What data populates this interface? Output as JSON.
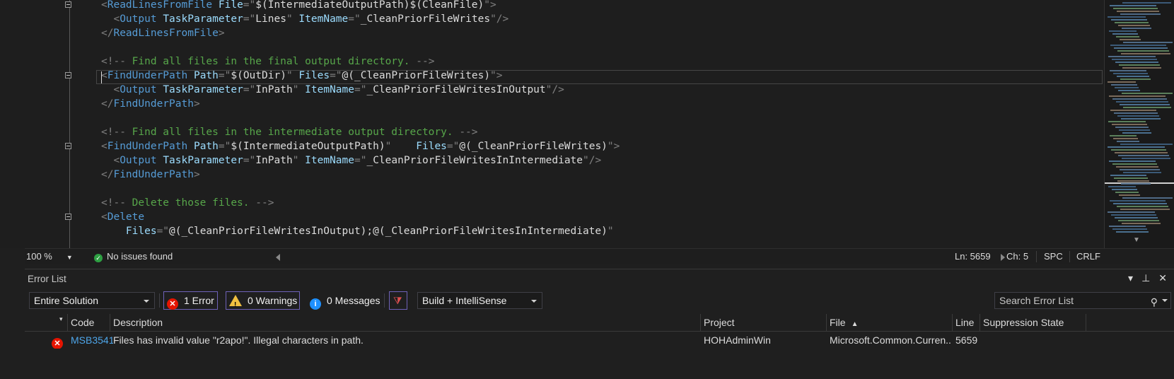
{
  "editor": {
    "lines": [
      [
        [
          "t-punc",
          "<"
        ],
        [
          "t-tag",
          "ReadLinesFromFile"
        ],
        [
          "t-txt",
          " "
        ],
        [
          "t-attr",
          "File"
        ],
        [
          "t-punc",
          "=\""
        ],
        [
          "t-txt",
          "$(IntermediateOutputPath)$(CleanFile)"
        ],
        [
          "t-punc",
          "\">"
        ]
      ],
      [
        [
          "t-txt",
          "  "
        ],
        [
          "t-punc",
          "<"
        ],
        [
          "t-tag",
          "Output"
        ],
        [
          "t-txt",
          " "
        ],
        [
          "t-attr",
          "TaskParameter"
        ],
        [
          "t-punc",
          "=\""
        ],
        [
          "t-txt",
          "Lines"
        ],
        [
          "t-punc",
          "\""
        ],
        [
          "t-txt",
          " "
        ],
        [
          "t-attr",
          "ItemName"
        ],
        [
          "t-punc",
          "=\""
        ],
        [
          "t-txt",
          "_CleanPriorFileWrites"
        ],
        [
          "t-punc",
          "\"/>"
        ]
      ],
      [
        [
          "t-punc",
          "</"
        ],
        [
          "t-tag",
          "ReadLinesFromFile"
        ],
        [
          "t-punc",
          ">"
        ]
      ],
      [],
      [
        [
          "t-punc",
          "<!--"
        ],
        [
          "t-comm",
          " Find all files in the final output directory. "
        ],
        [
          "t-punc",
          "-->"
        ]
      ],
      [
        [
          "t-punc",
          "<"
        ],
        [
          "t-tag",
          "FindUnderPath"
        ],
        [
          "t-txt",
          " "
        ],
        [
          "t-attr",
          "Path"
        ],
        [
          "t-punc",
          "=\""
        ],
        [
          "t-txt",
          "$(OutDir)"
        ],
        [
          "t-punc",
          "\""
        ],
        [
          "t-txt",
          " "
        ],
        [
          "t-attr",
          "Files"
        ],
        [
          "t-punc",
          "=\""
        ],
        [
          "t-txt",
          "@(_CleanPriorFileWrites)"
        ],
        [
          "t-punc",
          "\">"
        ]
      ],
      [
        [
          "t-txt",
          "  "
        ],
        [
          "t-punc",
          "<"
        ],
        [
          "t-tag",
          "Output"
        ],
        [
          "t-txt",
          " "
        ],
        [
          "t-attr",
          "TaskParameter"
        ],
        [
          "t-punc",
          "=\""
        ],
        [
          "t-txt",
          "InPath"
        ],
        [
          "t-punc",
          "\""
        ],
        [
          "t-txt",
          " "
        ],
        [
          "t-attr",
          "ItemName"
        ],
        [
          "t-punc",
          "=\""
        ],
        [
          "t-txt",
          "_CleanPriorFileWritesInOutput"
        ],
        [
          "t-punc",
          "\"/>"
        ]
      ],
      [
        [
          "t-punc",
          "</"
        ],
        [
          "t-tag",
          "FindUnderPath"
        ],
        [
          "t-punc",
          ">"
        ]
      ],
      [],
      [
        [
          "t-punc",
          "<!--"
        ],
        [
          "t-comm",
          " Find all files in the intermediate output directory. "
        ],
        [
          "t-punc",
          "-->"
        ]
      ],
      [
        [
          "t-punc",
          "<"
        ],
        [
          "t-tag",
          "FindUnderPath"
        ],
        [
          "t-txt",
          " "
        ],
        [
          "t-attr",
          "Path"
        ],
        [
          "t-punc",
          "=\""
        ],
        [
          "t-txt",
          "$(IntermediateOutputPath)"
        ],
        [
          "t-punc",
          "\""
        ],
        [
          "t-txt",
          "    "
        ],
        [
          "t-attr",
          "Files"
        ],
        [
          "t-punc",
          "=\""
        ],
        [
          "t-txt",
          "@(_CleanPriorFileWrites)"
        ],
        [
          "t-punc",
          "\">"
        ]
      ],
      [
        [
          "t-txt",
          "  "
        ],
        [
          "t-punc",
          "<"
        ],
        [
          "t-tag",
          "Output"
        ],
        [
          "t-txt",
          " "
        ],
        [
          "t-attr",
          "TaskParameter"
        ],
        [
          "t-punc",
          "=\""
        ],
        [
          "t-txt",
          "InPath"
        ],
        [
          "t-punc",
          "\""
        ],
        [
          "t-txt",
          " "
        ],
        [
          "t-attr",
          "ItemName"
        ],
        [
          "t-punc",
          "=\""
        ],
        [
          "t-txt",
          "_CleanPriorFileWritesInIntermediate"
        ],
        [
          "t-punc",
          "\"/>"
        ]
      ],
      [
        [
          "t-punc",
          "</"
        ],
        [
          "t-tag",
          "FindUnderPath"
        ],
        [
          "t-punc",
          ">"
        ]
      ],
      [],
      [
        [
          "t-punc",
          "<!--"
        ],
        [
          "t-comm",
          " Delete those files. "
        ],
        [
          "t-punc",
          "-->"
        ]
      ],
      [
        [
          "t-punc",
          "<"
        ],
        [
          "t-tag",
          "Delete"
        ]
      ],
      [
        [
          "t-txt",
          "    "
        ],
        [
          "t-attr",
          "Files"
        ],
        [
          "t-punc",
          "=\""
        ],
        [
          "t-txt",
          "@(_CleanPriorFileWritesInOutput);@(_CleanPriorFileWritesInIntermediate)"
        ],
        [
          "t-punc",
          "\""
        ]
      ]
    ]
  },
  "status": {
    "zoom": "100 %",
    "issues": "No issues found",
    "line": "Ln: 5659",
    "col": "Ch: 5",
    "whitespace": "SPC",
    "eol": "CRLF"
  },
  "panel": {
    "title": "Error List",
    "scope": "Entire Solution",
    "errors": "1 Error",
    "warnings": "0 Warnings",
    "messages": "0 Messages",
    "source": "Build + IntelliSense",
    "search_placeholder": "Search Error List",
    "columns": {
      "code": "Code",
      "description": "Description",
      "project": "Project",
      "file": "File",
      "line": "Line",
      "suppression": "Suppression State"
    },
    "rows": [
      {
        "code": "MSB3541",
        "description": "Files has invalid value \"r2apo!\". Illegal characters in path.",
        "project": "HOHAdminWin",
        "file": "Microsoft.Common.Curren...",
        "line": "5659",
        "suppression": ""
      }
    ]
  }
}
